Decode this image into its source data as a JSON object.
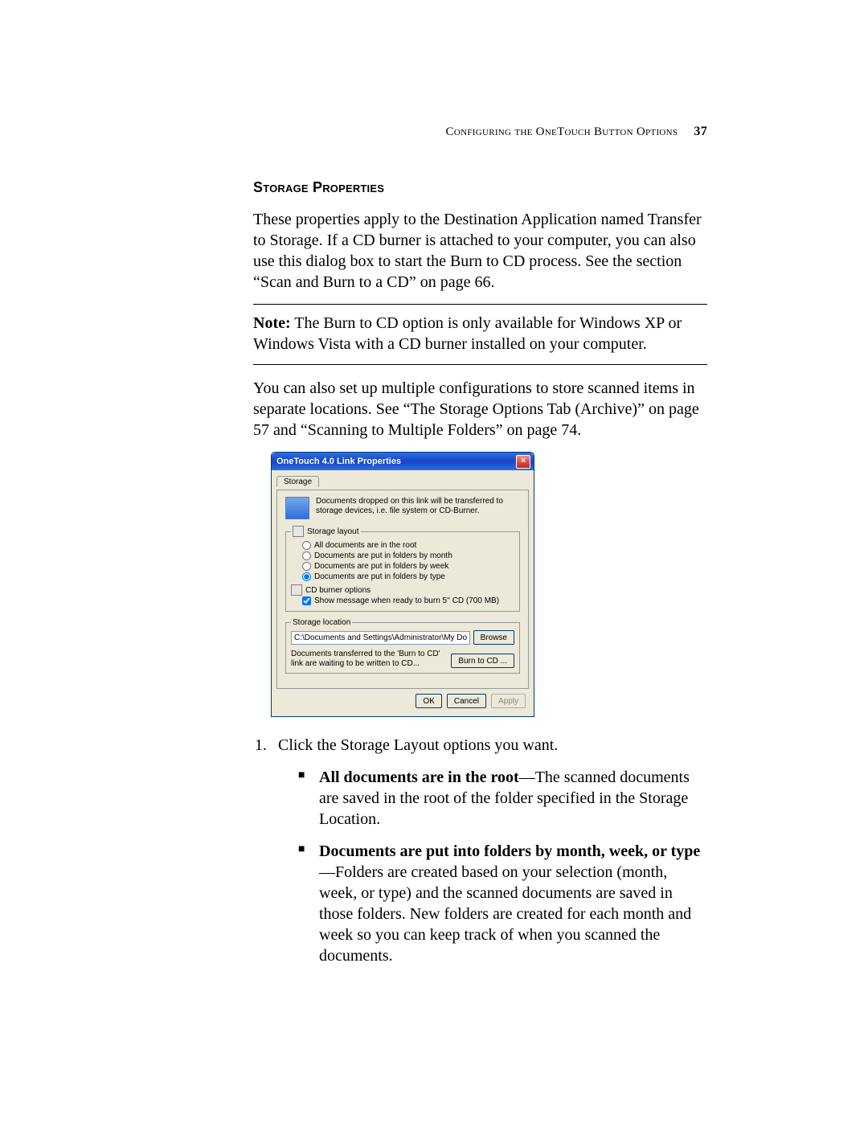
{
  "header": {
    "running_title": "Configuring the OneTouch Button Options",
    "page_number": "37"
  },
  "section_heading": "Storage Properties",
  "intro_para": "These properties apply to the Destination Application named Transfer to Storage. If a CD burner is attached to your computer, you can also use this dialog box to start the Burn to CD process. See the section “Scan and Burn to a CD” on page 66.",
  "note": {
    "label": "Note:",
    "text": " The Burn to CD option is only available for Windows XP or Windows Vista with a CD burner installed on your computer."
  },
  "after_note_para": "You can also set up multiple configurations to store scanned items in separate locations. See “The Storage Options Tab (Archive)” on page 57 and “Scanning to Multiple Folders” on page 74.",
  "dialog": {
    "title": "OneTouch 4.0 Link Properties",
    "tab_label": "Storage",
    "description": "Documents dropped on this link will be transferred to storage devices, i.e. file system or CD-Burner.",
    "storage_layout_legend": "Storage layout",
    "layout_options": [
      {
        "label": "All documents are in the root",
        "selected": false
      },
      {
        "label": "Documents are put in folders by month",
        "selected": false
      },
      {
        "label": "Documents are put in folders by week",
        "selected": false
      },
      {
        "label": "Documents are put in folders by type",
        "selected": true
      }
    ],
    "cd_burner_header": "CD burner options",
    "cd_burner_checkbox": {
      "label": "Show message when ready to burn 5'' CD (700 MB)",
      "checked": true
    },
    "storage_location_legend": "Storage location",
    "storage_path": "C:\\Documents and Settings\\Administrator\\My Do",
    "browse_btn": "Browse",
    "burn_note": "Documents transferred to the 'Burn to CD' link are waiting to be written to CD...",
    "burn_btn": "Burn to CD ...",
    "buttons": {
      "ok": "OK",
      "cancel": "Cancel",
      "apply": "Apply"
    }
  },
  "step1_text": "Click the Storage Layout options you want.",
  "bullets": [
    {
      "bold": "All documents are in the root",
      "rest": "—The scanned documents are saved in the root of the folder specified in the Storage Location."
    },
    {
      "bold": "Documents are put into folders by month, week, or type",
      "rest": "—Folders are created based on your selection (month, week, or type) and the scanned documents are saved in those folders. New folders are created for each month and week so you can keep track of when you scanned the documents."
    }
  ]
}
